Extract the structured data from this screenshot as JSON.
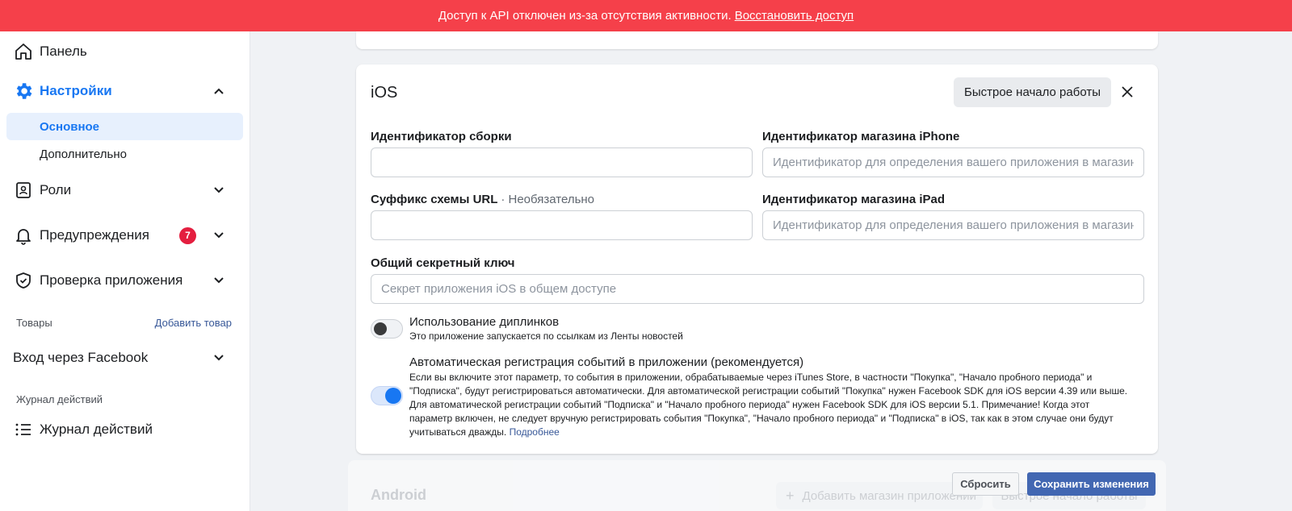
{
  "banner": {
    "message": "Доступ к API отключен из-за отсутствия активности.",
    "link": "Восстановить доступ"
  },
  "sidebar": {
    "panel": "Панель",
    "settings": "Настройки",
    "settings_sub": [
      "Основное",
      "Дополнительно"
    ],
    "roles": "Роли",
    "alerts": "Предупреждения",
    "alerts_badge": "7",
    "app_review": "Проверка приложения",
    "products_label": "Товары",
    "add_product": "Добавить товар",
    "fb_login": "Вход через Facebook",
    "activity_label": "Журнал действий",
    "activity_log": "Журнал действий"
  },
  "ios": {
    "title": "iOS",
    "quick_start": "Быстрое начало работы",
    "bundle_id_label": "Идентификатор сборки",
    "bundle_id_value": "",
    "iphone_store_label": "Идентификатор магазина iPhone",
    "iphone_store_placeholder": "Идентификатор для определения вашего приложения в магазин...",
    "url_suffix_label": "Суффикс схемы URL",
    "url_suffix_optional": "· Необязательно",
    "url_suffix_value": "",
    "ipad_store_label": "Идентификатор магазина iPad",
    "ipad_store_placeholder": "Идентификатор для определения вашего приложения в магазин...",
    "shared_secret_label": "Общий секретный ключ",
    "shared_secret_placeholder": "Секрет приложения iOS в общем доступе",
    "deeplink_title": "Использование диплинков",
    "deeplink_desc": "Это приложение запускается по ссылкам из Ленты новостей",
    "deeplink_on": false,
    "autolog_title": "Автоматическая регистрация событий в приложении (рекомендуется)",
    "autolog_desc_lines": [
      "Если вы включите этот параметр, то события в приложении, обрабатываемые через iTunes Store, в частности \"Покупка\", \"Начало пробного периода\" и",
      "\"Подписка\", будут регистрироваться автоматически. Для автоматической регистрации событий \"Покупка\" нужен Facebook SDK для iOS версии 4.39 или выше.",
      "Для автоматической регистрации событий \"Подписка\" и \"Начало пробного периода\" нужен Facebook SDK для iOS версии 5.1. Примечание! Когда этот",
      "параметр включен, не следует вручную регистрировать события \"Покупка\", \"Начало пробного периода\" и \"Подписка\" в iOS, так как в этом случае они будут",
      "учитываться дважды."
    ],
    "autolog_more": "Подробнее",
    "autolog_on": true
  },
  "android": {
    "title": "Android",
    "add_store": "Добавить магазин приложений",
    "quick_start": "Быстрое начало работы"
  },
  "footer": {
    "reset": "Сбросить",
    "save": "Сохранить изменения"
  },
  "colors": {
    "banner": "#f5404a",
    "accent": "#1877f2",
    "save_button": "#4267b2",
    "badge": "#e41e3f"
  }
}
